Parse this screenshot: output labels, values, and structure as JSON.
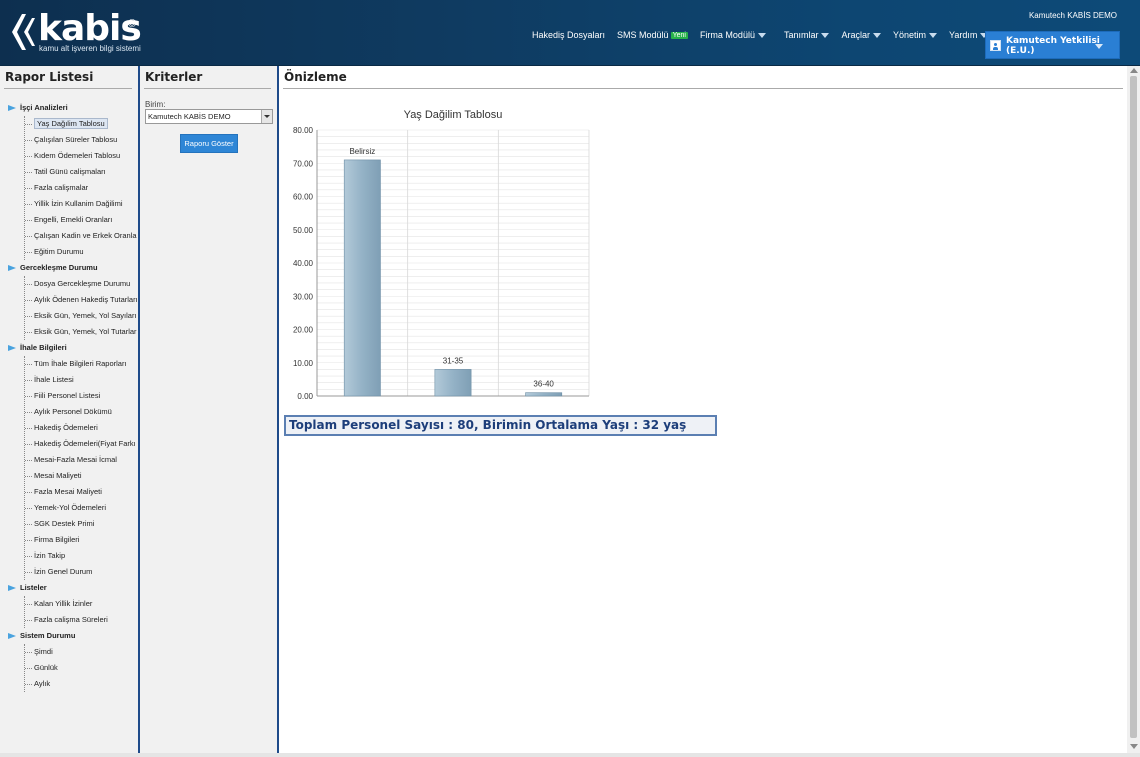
{
  "header": {
    "logo_text": "kabis",
    "logo_copyright": "©",
    "logo_subtitle": "kamu alt işveren bilgi sistemi",
    "company_top": "Kamutech KABİS DEMO",
    "nav": [
      {
        "label": "Hakediş Dosyaları",
        "dropdown": false
      },
      {
        "label": "SMS Modülü",
        "badge": "Yeni",
        "dropdown": false
      },
      {
        "label": "Firma Modülü",
        "dropdown": true
      },
      {
        "label": "Tanımlar",
        "dropdown": true
      },
      {
        "label": "Araçlar",
        "dropdown": true
      },
      {
        "label": "Yönetim",
        "dropdown": true
      },
      {
        "label": "Yardım",
        "dropdown": true
      }
    ],
    "user": {
      "line1": "Kamutech Yetkilisi",
      "line2": "(E.U.)"
    }
  },
  "left_panel": {
    "title": "Rapor Listesi",
    "groups": [
      {
        "label": "İşçi Analizleri",
        "items": [
          "Yaş Dağılim Tablosu",
          "Çalışılan Süreler Tablosu",
          "Kıdem Ödemeleri Tablosu",
          "Tatil Günü calişmaları",
          "Fazla calişmalar",
          "Yillik İzin Kullanim Dağilimi",
          "Engelli, Emekli Oranları",
          "Çalışan Kadin ve Erkek Oranla",
          "Eğitim Durumu"
        ]
      },
      {
        "label": "Gercekleşme Durumu",
        "items": [
          "Dosya Gercekleşme Durumu",
          "Aylık Ödenen Hakediş Tutarları",
          "Eksik Gün, Yemek, Yol Sayıları",
          "Eksik Gün, Yemek, Yol Tutarlar"
        ]
      },
      {
        "label": "İhale Bilgileri",
        "items": [
          "Tüm İhale Bilgileri Raporları",
          "İhale Listesi",
          "Fiili Personel Listesi",
          "Aylık Personel Dökümü",
          "Hakediş Ödemeleri",
          "Hakediş Ödemeleri(Fiyat Farkı",
          "Mesai-Fazla Mesai İcmal",
          "Mesai Maliyeti",
          "Fazla Mesai Maliyeti",
          "Yemek-Yol Ödemeleri",
          "SGK Destek Primi",
          "Firma Bilgileri",
          "İzin Takip",
          "İzin Genel Durum"
        ]
      },
      {
        "label": "Listeler",
        "items": [
          "Kalan Yillik İzinler",
          "Fazla calişma Süreleri"
        ]
      },
      {
        "label": "Sistem Durumu",
        "items": [
          "Şimdi",
          "Günlük",
          "Aylık"
        ]
      }
    ],
    "selected_item": "Yaş Dağılim Tablosu"
  },
  "mid_panel": {
    "title": "Kriterler",
    "unit_label": "Birim:",
    "unit_value": "Kamutech KABİS DEMO",
    "button_label": "Raporu Göster"
  },
  "right_panel": {
    "title": "Önizleme",
    "summary": "Toplam Personel Sayısı : 80, Birimin Ortalama Yaşı : 32 yaş"
  },
  "colors": {
    "header_bg": "#0f3b61",
    "accent_blue": "#2e86d6",
    "panel_border": "#1f4b8a",
    "bar_fill": "#9ab6c9"
  },
  "chart_data": {
    "type": "bar",
    "title": "Yaş Dağilim Tablosu",
    "categories": [
      "Belirsiz",
      "31-35",
      "36-40"
    ],
    "values": [
      71,
      8,
      1
    ],
    "ylim": [
      0,
      80
    ],
    "yticks": [
      "0.00",
      "10.00",
      "20.00",
      "30.00",
      "40.00",
      "50.00",
      "60.00",
      "70.00",
      "80.00"
    ],
    "grid": true,
    "legend": "none"
  }
}
